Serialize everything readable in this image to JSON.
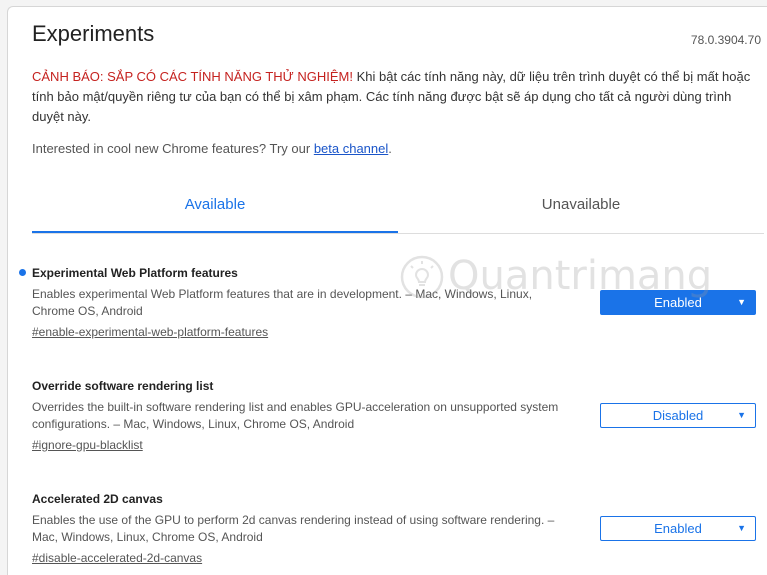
{
  "header": {
    "title": "Experiments",
    "version": "78.0.3904.70"
  },
  "warning": {
    "lead": "CẢNH BÁO: SẮP CÓ CÁC TÍNH NĂNG THỬ NGHIỆM!",
    "body": " Khi bật các tính năng này, dữ liệu trên trình duyệt có thể bị mất hoặc tính bảo mật/quyền riêng tư của bạn có thể bị xâm phạm. Các tính năng được bật sẽ áp dụng cho tất cả người dùng trình duyệt này."
  },
  "promo": {
    "text": "Interested in cool new Chrome features? Try our ",
    "link": "beta channel",
    "suffix": "."
  },
  "tabs": [
    {
      "label": "Available",
      "active": true
    },
    {
      "label": "Unavailable",
      "active": false
    }
  ],
  "experiments": [
    {
      "title": "Experimental Web Platform features",
      "description": "Enables experimental Web Platform features that are in development. – Mac, Windows, Linux, Chrome OS, Android",
      "link": "#enable-experimental-web-platform-features",
      "value": "Enabled",
      "modified": true
    },
    {
      "title": "Override software rendering list",
      "description": "Overrides the built-in software rendering list and enables GPU-acceleration on unsupported system configurations. – Mac, Windows, Linux, Chrome OS, Android",
      "link": "#ignore-gpu-blacklist",
      "value": "Disabled",
      "modified": false
    },
    {
      "title": "Accelerated 2D canvas",
      "description": "Enables the use of the GPU to perform 2d canvas rendering instead of using software rendering. – Mac, Windows, Linux, Chrome OS, Android",
      "link": "#disable-accelerated-2d-canvas",
      "value": "Enabled",
      "modified": false
    }
  ],
  "select_arrow": "▼",
  "watermark": {
    "text": "Quantrimang",
    "icon": "lightbulb-icon"
  },
  "colors": {
    "accent": "#1a73e8",
    "warning": "#c5221f",
    "link": "#1a55c9"
  }
}
